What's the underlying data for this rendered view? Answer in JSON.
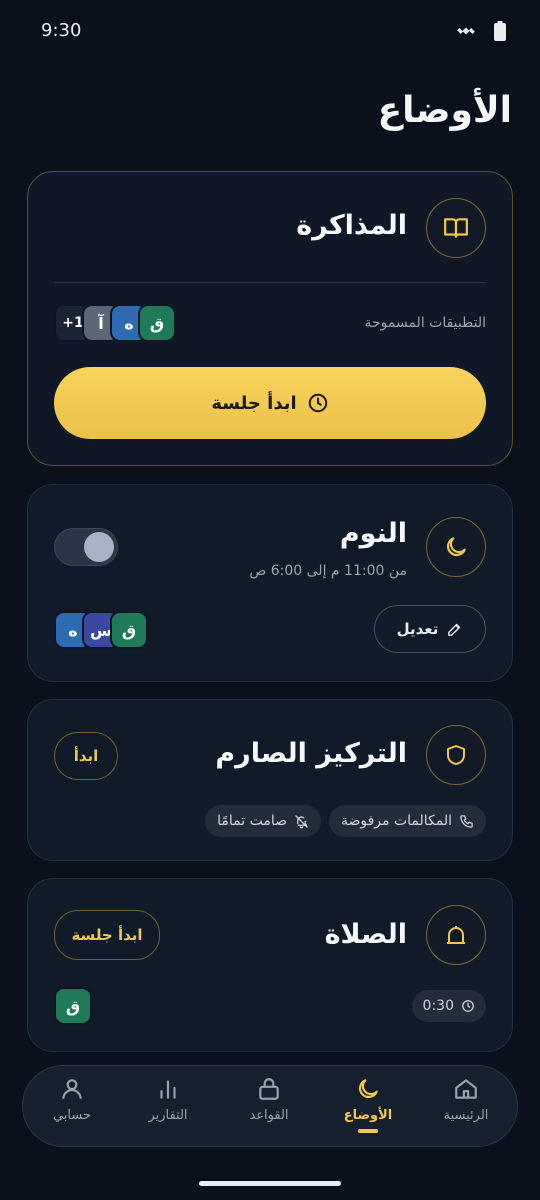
{
  "status": {
    "time": "9:30"
  },
  "page": {
    "title": "الأوضاع"
  },
  "study": {
    "title": "المذاكرة",
    "allowed_label": "التطبيقات المسموحة",
    "apps": [
      "ق",
      "ه",
      "آ",
      "+1"
    ],
    "start_label": "ابدأ جلسة",
    "icon": "book-icon"
  },
  "sleep": {
    "title": "النوم",
    "schedule": "من 11:00 م إلى 6:00 ص",
    "edit_label": "تعديل",
    "apps": [
      "ق",
      "س",
      "ه"
    ],
    "toggle_on": false,
    "icon": "moon-icon"
  },
  "strict": {
    "title": "التركيز الصارم",
    "start_label": "ابدأ",
    "tags": [
      "المكالمات مرفوضة",
      "صامت تمامًا"
    ],
    "icon": "shield-icon"
  },
  "prayer": {
    "title": "الصلاة",
    "start_label": "ابدأ جلسة",
    "duration": "0:30",
    "apps": [
      "ق"
    ],
    "icon": "mosque-icon"
  },
  "nav": {
    "items": [
      {
        "label": "الرئيسية",
        "icon": "home-icon",
        "active": false
      },
      {
        "label": "الأوضاع",
        "icon": "moon-icon",
        "active": true
      },
      {
        "label": "القواعد",
        "icon": "lock-icon",
        "active": false
      },
      {
        "label": "التقارير",
        "icon": "bar-chart-icon",
        "active": false
      },
      {
        "label": "حسابي",
        "icon": "person-icon",
        "active": false
      }
    ]
  },
  "colors": {
    "accent": "#f0c84e",
    "background": "#0b111c",
    "card": "#111a28"
  }
}
